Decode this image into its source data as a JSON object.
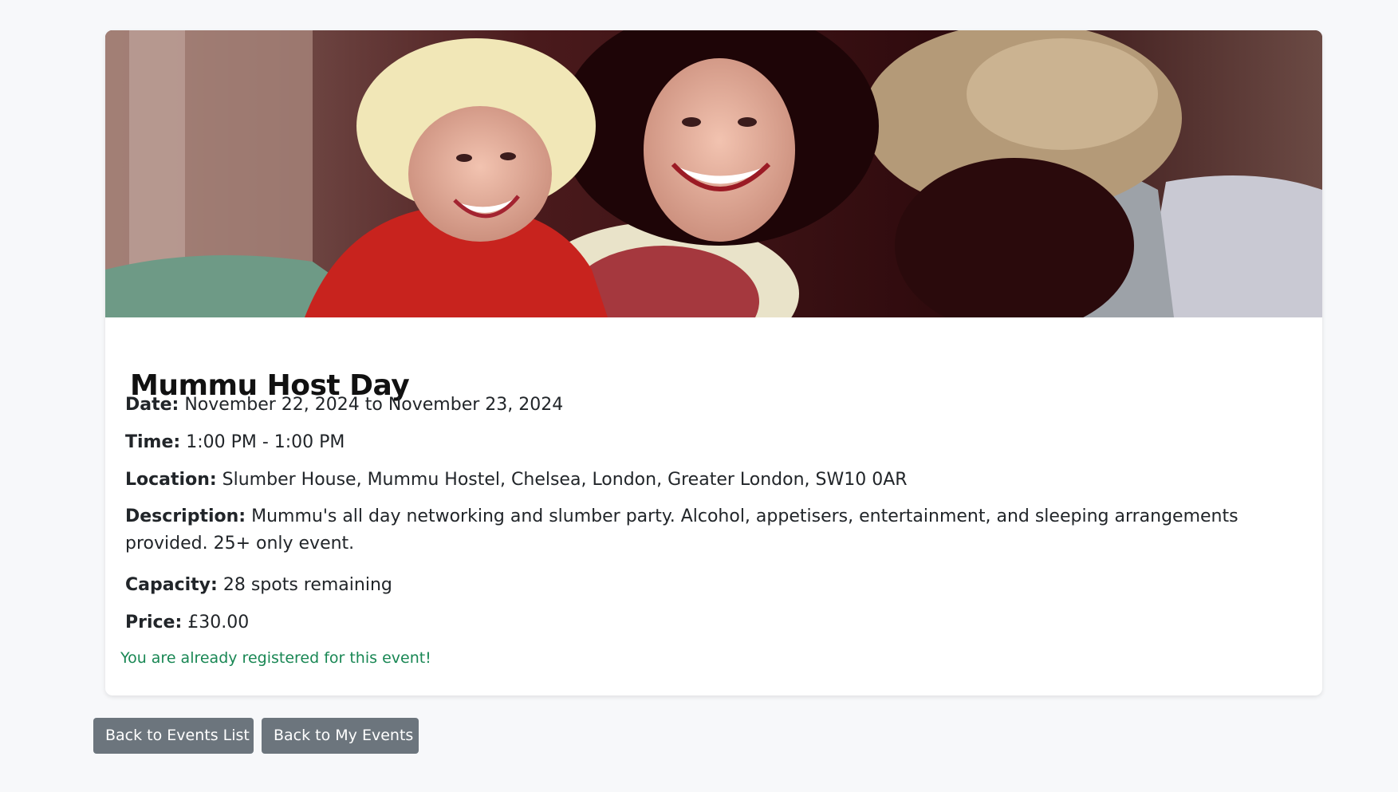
{
  "event": {
    "image": {
      "description_icon": "event-photo",
      "palette": [
        "#3a0d10",
        "#c8231e",
        "#e9e3c9",
        "#b49a78",
        "#f1e7b7",
        "#9aa39a"
      ]
    },
    "title": "Mummu Host Day",
    "date_label": "Date:",
    "date_value": "November 22, 2024 to November 23, 2024",
    "time_label": "Time:",
    "time_value": "1:00 PM - 1:00 PM",
    "location_label": "Location:",
    "location_value": "Slumber House, Mummu Hostel, Chelsea, London, Greater London, SW10 0AR",
    "description_label": "Description:",
    "description_value": "Mummu's all day networking and slumber party. Alcohol, appetisers, entertainment, and sleeping arrangements provided. 25+ only event.",
    "capacity_label": "Capacity:",
    "capacity_value": "28 spots remaining",
    "price_label": "Price:",
    "price_value": "£30.00",
    "registered_message": "You are already registered for this event!"
  },
  "actions": {
    "back_to_events_label": "Back to Events List",
    "back_to_my_events_label": "Back to My Events"
  },
  "colors": {
    "page_background": "#f7f8fa",
    "card_background": "#ffffff",
    "button_background": "#6c757d",
    "success_text": "#198754"
  }
}
